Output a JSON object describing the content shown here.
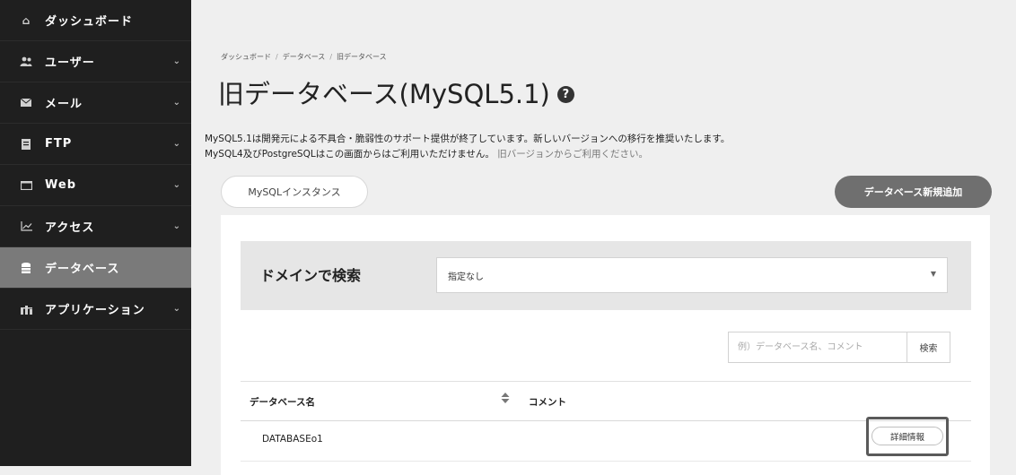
{
  "sidebar": {
    "items": [
      {
        "label": "ダッシュボード",
        "icon": "home-icon",
        "glyph": "⌂",
        "chevron": false,
        "active": false
      },
      {
        "label": "ユーザー",
        "icon": "users-icon",
        "glyph": "👥",
        "chevron": true,
        "active": false
      },
      {
        "label": "メール",
        "icon": "mail-icon",
        "glyph": "✉",
        "chevron": true,
        "active": false
      },
      {
        "label": "FTP",
        "icon": "file-icon",
        "glyph": "▤",
        "chevron": true,
        "active": false
      },
      {
        "label": "Web",
        "icon": "window-icon",
        "glyph": "▭",
        "chevron": true,
        "active": false
      },
      {
        "label": "アクセス",
        "icon": "chart-icon",
        "glyph": "⟋",
        "chevron": true,
        "active": false
      },
      {
        "label": "データベース",
        "icon": "database-icon",
        "glyph": "≡",
        "chevron": false,
        "active": true
      },
      {
        "label": "アプリケーション",
        "icon": "apps-icon",
        "glyph": "⛬",
        "chevron": true,
        "active": false
      }
    ]
  },
  "breadcrumb": [
    "ダッシュボード",
    "データベース",
    "旧データベース"
  ],
  "page": {
    "title": "旧データベース(MySQL5.1)",
    "help_glyph": "?",
    "desc_line1": "MySQL5.1は開発元による不具合・脆弱性のサポート提供が終了しています。新しいバージョンへの移行を推奨いたします。",
    "desc_line2": "MySQL4及びPostgreSQLはこの画面からはご利用いただけません。",
    "desc_link": "旧バージョンからご利用ください。"
  },
  "buttons": {
    "mysql_instance": "MySQLインスタンス",
    "add_database": "データベース新規追加"
  },
  "search": {
    "label": "ドメインで検索",
    "domain_selected": "指定なし",
    "keyword_placeholder": "例）データベース名、コメント",
    "button": "検索"
  },
  "table": {
    "headers": {
      "name": "データベース名",
      "comment": "コメント"
    },
    "rows": [
      {
        "name": "DATABASEo1",
        "comment": "",
        "action": "詳細情報"
      }
    ]
  }
}
